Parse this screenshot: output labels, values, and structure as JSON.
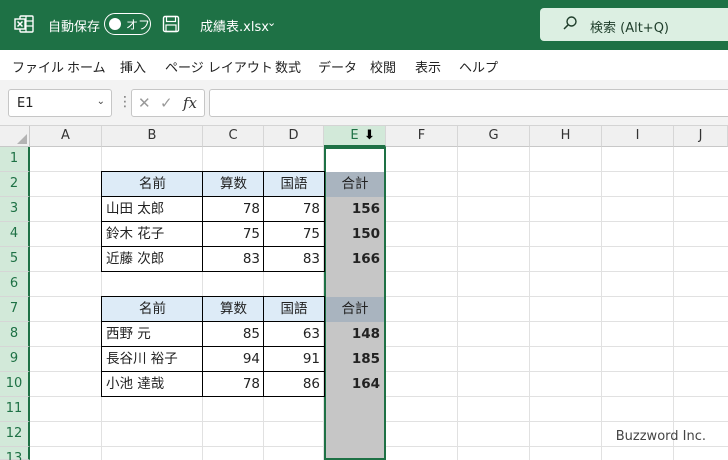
{
  "titlebar": {
    "autosave_label": "自動保存",
    "toggle_label": "オフ",
    "filename": "成績表.xlsx",
    "search_placeholder": "検索 (Alt+Q)",
    "bg_color": "#1e7145"
  },
  "menu": [
    "ファイル",
    "ホーム",
    "挿入",
    "ページ レイアウト",
    "数式",
    "データ",
    "校閲",
    "表示",
    "ヘルプ"
  ],
  "formula_bar": {
    "name_box": "E1",
    "fx": "fx",
    "content": ""
  },
  "columns": [
    "A",
    "B",
    "C",
    "D",
    "E",
    "F",
    "G",
    "H",
    "I",
    "J"
  ],
  "rows": [
    "1",
    "2",
    "3",
    "4",
    "5",
    "6",
    "7",
    "8",
    "9",
    "10",
    "11",
    "12",
    "13"
  ],
  "table1": {
    "headers": [
      "名前",
      "算数",
      "国語",
      "合計"
    ],
    "rows": [
      [
        "山田 太郎",
        "78",
        "78",
        "156"
      ],
      [
        "鈴木 花子",
        "75",
        "75",
        "150"
      ],
      [
        "近藤 次郎",
        "83",
        "83",
        "166"
      ]
    ]
  },
  "table2": {
    "headers": [
      "名前",
      "算数",
      "国語",
      "合計"
    ],
    "rows": [
      [
        "西野 元",
        "85",
        "63",
        "148"
      ],
      [
        "長谷川 裕子",
        "94",
        "91",
        "185"
      ],
      [
        "小池 達哉",
        "78",
        "86",
        "164"
      ]
    ]
  },
  "selected_column": "E",
  "watermark": "Buzzword Inc."
}
